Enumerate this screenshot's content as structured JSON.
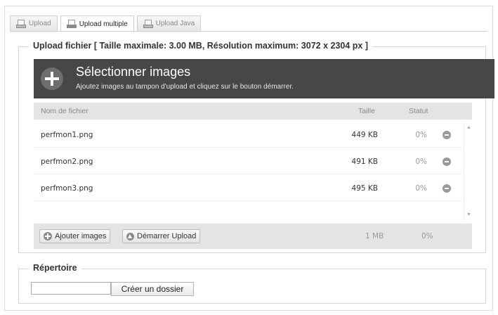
{
  "tabs": [
    {
      "label": "Upload",
      "active": false
    },
    {
      "label": "Upload multiple",
      "active": true
    },
    {
      "label": "Upload Java",
      "active": false
    }
  ],
  "upload_section": {
    "legend": "Upload fichier [ Taille maximale: 3.00 MB, Résolution maximum: 3072 x 2304 px ]",
    "header_title": "Sélectionner images",
    "header_subtitle": "Ajoutez images au tampon d'upload et cliquez sur le bouton démarrer."
  },
  "file_list": {
    "columns": {
      "name": "Nom de fichier",
      "size": "Taille",
      "status": "Statut"
    },
    "rows": [
      {
        "name": "perfmon1.png",
        "size": "449 KB",
        "status": "0%"
      },
      {
        "name": "perfmon2.png",
        "size": "491 KB",
        "status": "0%"
      },
      {
        "name": "perfmon3.png",
        "size": "495 KB",
        "status": "0%"
      }
    ],
    "footer": {
      "add_button": "Ajouter images",
      "start_button": "Démarrer Upload",
      "total_size": "1 MB",
      "total_status": "0%"
    }
  },
  "directory": {
    "legend": "Répertoire",
    "input_value": "",
    "create_button": "Créer un dossier"
  },
  "icons": {
    "tab_upload": "upload-tray-icon",
    "add_files": "plus-circle-icon",
    "remove_file": "minus-circle-icon",
    "start_upload": "arrow-up-circle-icon"
  },
  "colors": {
    "header_bg": "#474747",
    "list_header_bg": "#e4e4e4"
  }
}
